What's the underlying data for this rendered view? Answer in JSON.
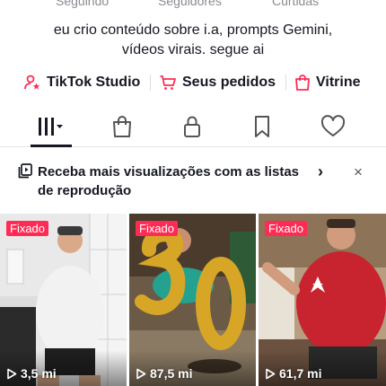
{
  "stats": {
    "following_label": "Seguindo",
    "followers_label": "Seguidores",
    "likes_label": "Curtidas"
  },
  "bio": {
    "line1": "eu crio conteúdo sobre i.a, prompts Gemini,",
    "line2": "vídeos virais. segue ai"
  },
  "links": [
    {
      "label": "TikTok Studio",
      "icon": "person-star-icon"
    },
    {
      "label": "Seus pedidos",
      "icon": "cart-icon"
    },
    {
      "label": "Vitrine",
      "icon": "shopping-bag-icon"
    }
  ],
  "tabs": [
    {
      "icon": "grid-bars-icon",
      "selected": true
    },
    {
      "icon": "shopping-bag-icon",
      "selected": false
    },
    {
      "icon": "lock-icon",
      "selected": false
    },
    {
      "icon": "bookmark-icon",
      "selected": false
    },
    {
      "icon": "heart-icon",
      "selected": false
    }
  ],
  "banner": {
    "text": "Receba mais visualizações com as listas de reprodução",
    "arrow": "›",
    "close": "×"
  },
  "videos": [
    {
      "pinned_label": "Fixado",
      "views": "3,5 mi"
    },
    {
      "pinned_label": "Fixado",
      "views": "87,5 mi"
    },
    {
      "pinned_label": "Fixado",
      "views": "61,7 mi"
    }
  ],
  "colors": {
    "accent": "#fe2c55",
    "text": "#161823",
    "muted": "#8a8b91"
  }
}
